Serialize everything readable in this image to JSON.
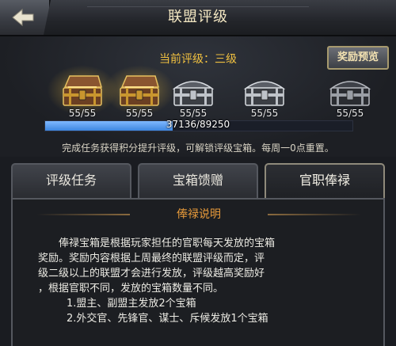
{
  "header": {
    "title": "联盟评级",
    "back_icon": "back-arrow-icon"
  },
  "rank": {
    "current_label": "当前评级：三级",
    "preview_button": "奖励预览"
  },
  "chests": [
    {
      "count": "55/55",
      "style": "gold-open",
      "glow": true
    },
    {
      "count": "55/55",
      "style": "gold-open",
      "glow": true
    },
    {
      "count": "55/55",
      "style": "silver",
      "glow": false
    },
    {
      "count": "55/55",
      "style": "silver",
      "glow": false
    },
    {
      "count": "55/55",
      "style": "dark",
      "glow": false
    }
  ],
  "progress": {
    "text": "37136/89250",
    "current": 37136,
    "max": 89250
  },
  "hint": "完成任务获得积分提升评级，可解锁评级宝箱。每周一0点重置。",
  "tabs": [
    {
      "label": "评级任务",
      "active": false
    },
    {
      "label": "宝箱馈赠",
      "active": false
    },
    {
      "label": "官职俸禄",
      "active": true
    }
  ],
  "panel": {
    "section_title": "俸禄说明",
    "paragraph": "俸禄宝箱是根据玩家担任的官职每天发放的宝箱奖励。奖励内容根据上周最终的联盟评级而定，评级二级以上的联盟才会进行发放，评级越高奖励好，根据官职不同，发放的宝箱数量不同。",
    "line1": "俸禄宝箱是根据玩家担任的官职每天发放的宝箱",
    "line2": "奖励。奖励内容根据上周最终的联盟评级而定，评",
    "line3": "级二级以上的联盟才会进行发放，评级越高奖励好",
    "line4": "，根据官职不同，发放的宝箱数量不同。",
    "item1": "1.盟主、副盟主发放2个宝箱",
    "item2": "2.外交官、先锋官、谋士、斥候发放1个宝箱"
  },
  "colors": {
    "accent_gold": "#f0c040",
    "section_orange": "#e79a3a",
    "progress_blue": "#3d86e0"
  }
}
